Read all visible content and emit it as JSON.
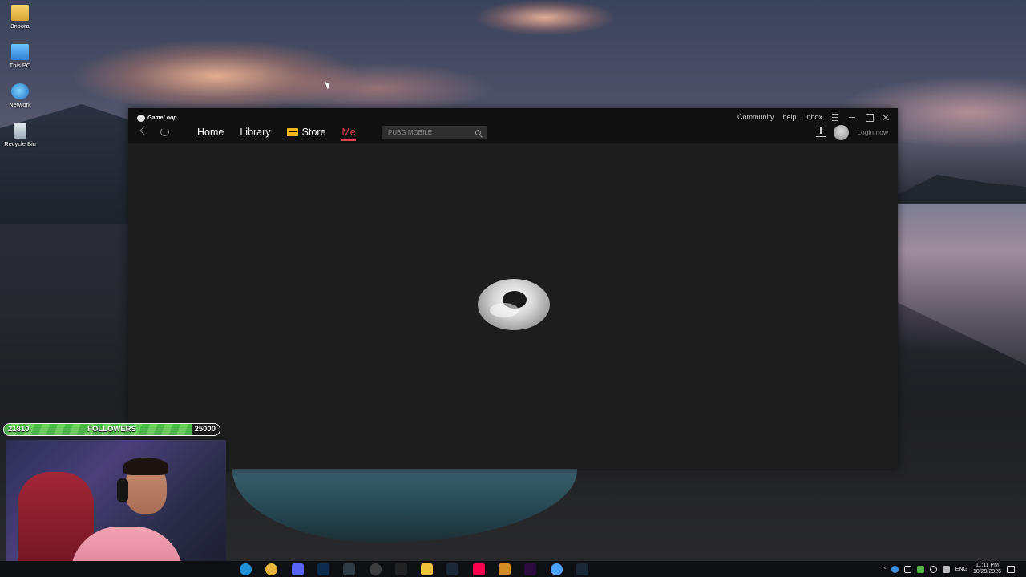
{
  "desktop": {
    "icons": [
      {
        "label": "3nbora",
        "icon": "folder-icon"
      },
      {
        "label": "This PC",
        "icon": "computer-icon"
      },
      {
        "label": "Network",
        "icon": "network-icon"
      },
      {
        "label": "Recycle Bin",
        "icon": "recycle-bin-icon"
      }
    ]
  },
  "gameloop": {
    "logo_text": "GameLoop",
    "top_links": {
      "community": "Community",
      "help": "help",
      "inbox": "inbox"
    },
    "tabs": [
      {
        "label": "Home"
      },
      {
        "label": "Library"
      },
      {
        "label": "Store",
        "icon": "store-icon"
      },
      {
        "label": "Me",
        "active": true
      }
    ],
    "search": {
      "placeholder": "PUBG MOBILE"
    },
    "login_label": "Login now",
    "accent_color": "#e8414e"
  },
  "stream_overlay": {
    "followers_current": "21810",
    "followers_label": "FOLLOWERS",
    "followers_goal": "25000",
    "progress_fraction": 0.8724
  },
  "taskbar": {
    "apps": [
      "edge-icon",
      "chrome-icon",
      "discord-icon",
      "photoshop-icon",
      "capcut-icon",
      "obs-icon",
      "4k-downloader-icon",
      "notes-icon",
      "steam-icon",
      "tiktok-icon",
      "game-icon",
      "premiere-icon",
      "gameloop-icon",
      "steam-icon"
    ],
    "language": "ENG",
    "time": "11:11 PM",
    "date": "10/29/2025"
  }
}
